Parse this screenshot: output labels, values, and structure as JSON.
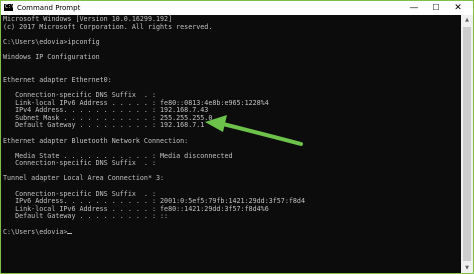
{
  "window": {
    "title": "Command Prompt",
    "icon": "cmd-icon",
    "icon_glyph": "C:\\",
    "minimize_glyph": "—",
    "maximize_glyph": "☐",
    "close_glyph": "✕"
  },
  "console": {
    "lines": [
      "Microsoft Windows [Version 10.0.16299.192]",
      "(c) 2017 Microsoft Corporation. All rights reserved.",
      "",
      "C:\\Users\\edovia>ipconfig",
      "",
      "Windows IP Configuration",
      "",
      "",
      "Ethernet adapter Ethernet0:",
      "",
      "   Connection-specific DNS Suffix  . :",
      "   Link-local IPv6 Address . . . . . : fe80::0813:4e8b:e965:1228%4",
      "   IPv4 Address. . . . . . . . . . . : 192.168.7.43",
      "   Subnet Mask . . . . . . . . . . . : 255.255.255.0",
      "   Default Gateway . . . . . . . . . : 192.168.7.1",
      "",
      "Ethernet adapter Bluetooth Network Connection:",
      "",
      "   Media State . . . . . . . . . . . : Media disconnected",
      "   Connection-specific DNS Suffix  . :",
      "",
      "Tunnel adapter Local Area Connection* 3:",
      "",
      "   Connection-specific DNS Suffix  . :",
      "   IPv6 Address. . . . . . . . . . . : 2001:0:5ef5:79fb:1421:29dd:3f57:f8d4",
      "   Link-local IPv6 Address . . . . . : fe80::1421:29dd:3f57:f8d4%6",
      "   Default Gateway . . . . . . . . . : ::",
      "",
      "C:\\Users\\edovia>"
    ]
  },
  "annotation": {
    "arrow_color": "#6cc24a",
    "points_to": "IPv4 Address"
  },
  "colors": {
    "console_bg": "#0c0c0c",
    "console_text": "#c0c0c0",
    "frame_border": "#7fbf4a"
  }
}
